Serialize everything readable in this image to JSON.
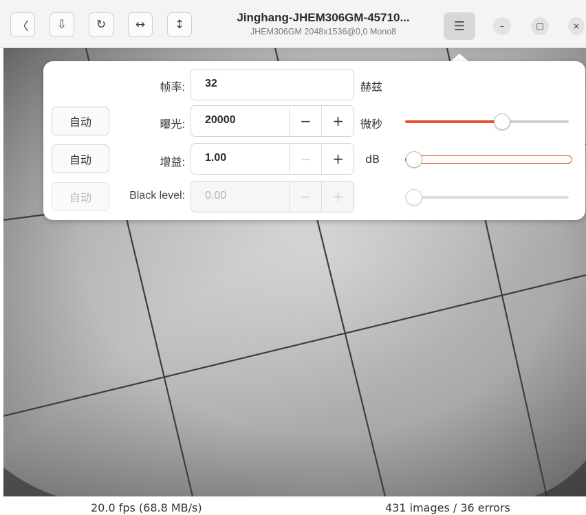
{
  "header": {
    "title": "Jinghang-JHEM306GM-45710...",
    "subtitle": "JHEM306GM 2048x1536@0,0 Mono8",
    "toolbar": [
      {
        "name": "back-button",
        "icon": "chevron-left-icon",
        "glyph": "〈"
      },
      {
        "name": "save-snapshot-button",
        "icon": "download-icon",
        "glyph": "⇩"
      },
      {
        "name": "rotate-button",
        "icon": "rotate-icon",
        "glyph": "↻"
      },
      {
        "name": "flip-horizontal-button",
        "icon": "flip-horizontal-icon",
        "glyph": "↔"
      },
      {
        "name": "flip-vertical-button",
        "icon": "flip-vertical-icon",
        "glyph": "↕"
      }
    ],
    "menu_glyph": "☰",
    "window": {
      "minimize": "–",
      "maximize": "□",
      "close": "×"
    }
  },
  "popover": {
    "rows": [
      {
        "key": "framerate",
        "auto_label": "",
        "label": "帧率:",
        "value": "32",
        "unit": "赫兹",
        "has_stepper": false
      },
      {
        "key": "exposure",
        "auto_label": "自动",
        "label": "曝光:",
        "value": "20000",
        "unit": "微秒",
        "has_stepper": true,
        "minus": "−",
        "plus": "+",
        "slider_fraction": 0.6
      },
      {
        "key": "gain",
        "auto_label": "自动",
        "label": "增益:",
        "value": "1.00",
        "unit": "dB",
        "has_stepper": true,
        "minus": "−",
        "plus": "+",
        "slider_fraction": 0.0
      },
      {
        "key": "black-level",
        "auto_label": "自动",
        "label": "Black level:",
        "value": "0.00",
        "unit": "",
        "has_stepper": true,
        "minus": "−",
        "plus": "+",
        "slider_fraction": 0.0,
        "disabled": true
      }
    ],
    "accent_color": "#e2572b"
  },
  "status": {
    "fps": "20.0 fps (68.8 MB/s)",
    "counts": "431 images / 36 errors"
  }
}
